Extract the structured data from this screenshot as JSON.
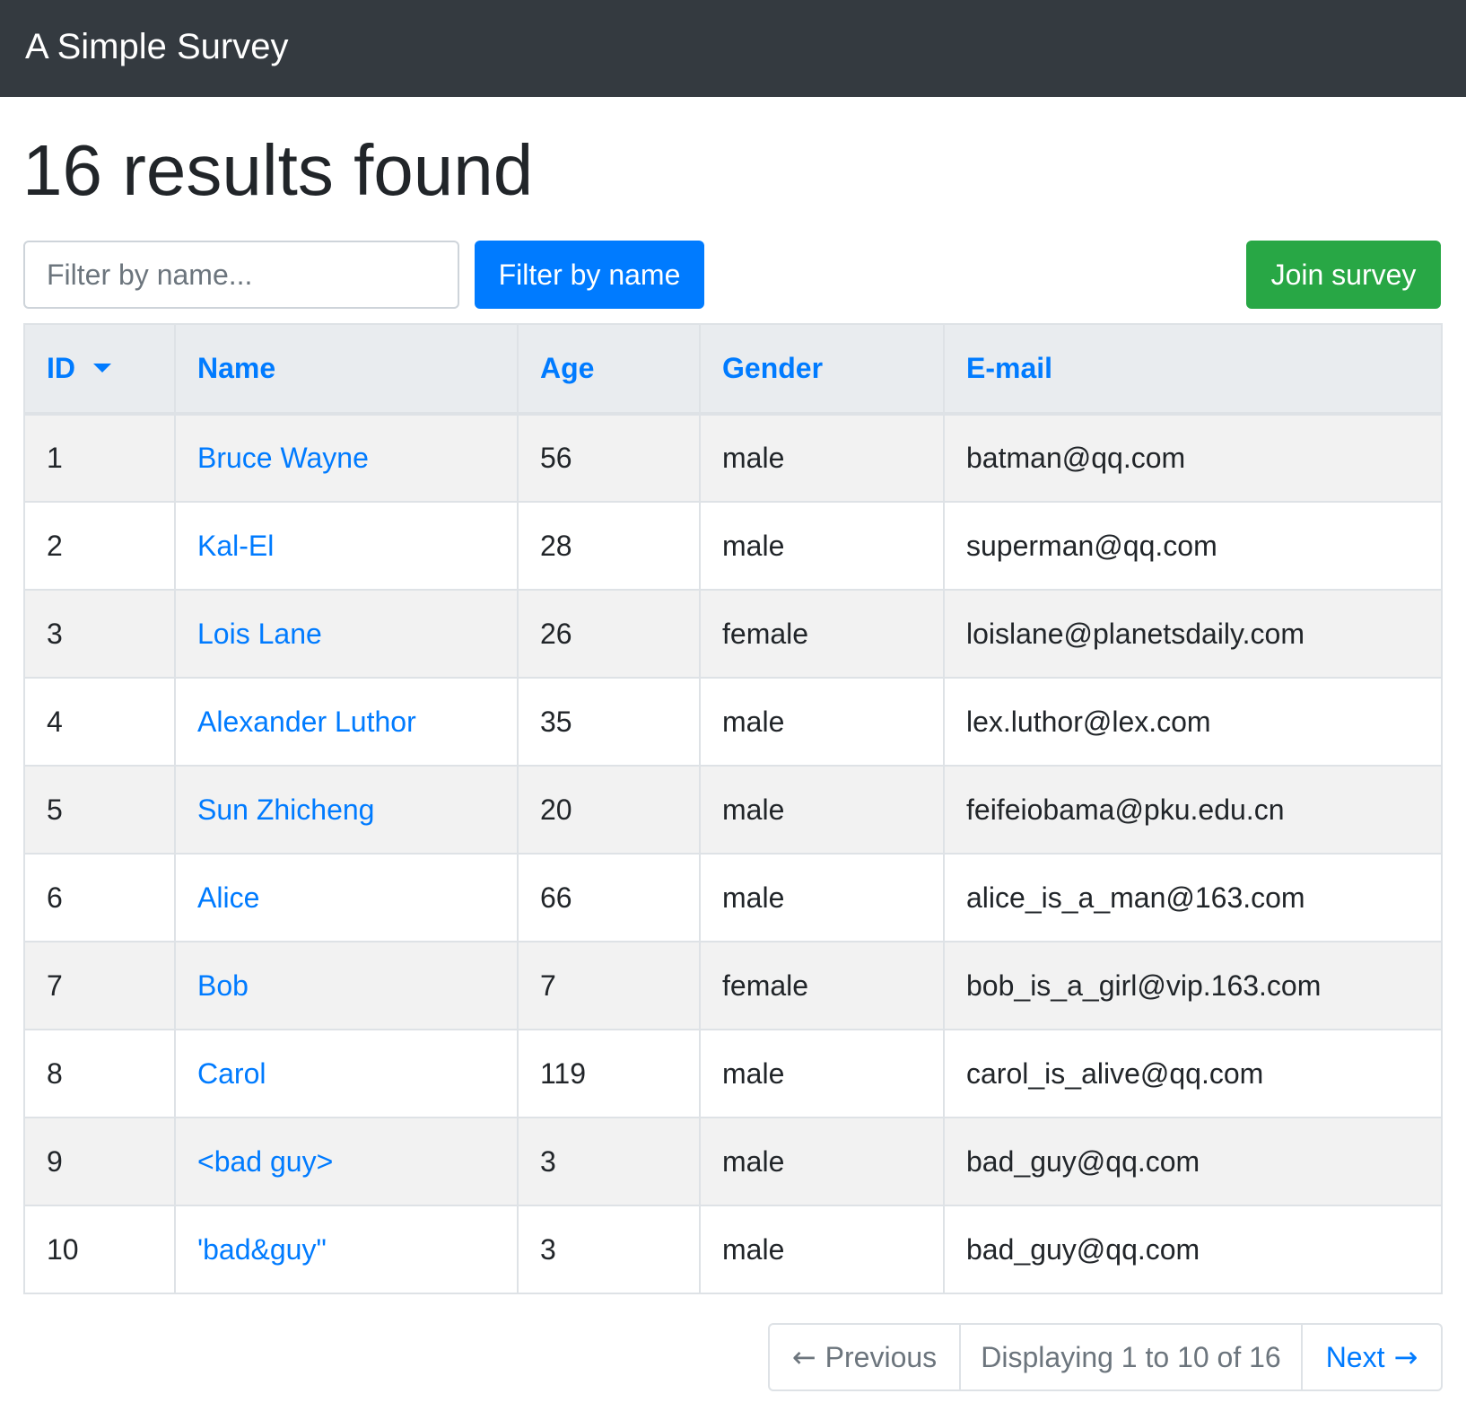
{
  "navbar": {
    "brand": "A Simple Survey"
  },
  "page": {
    "title": "16 results found"
  },
  "filter": {
    "placeholder": "Filter by name...",
    "value": "",
    "button_label": "Filter by name"
  },
  "join_button_label": "Join survey",
  "table": {
    "headers": [
      "ID",
      "Name",
      "Age",
      "Gender",
      "E-mail"
    ],
    "sort": {
      "column": "ID",
      "direction": "descending-caret"
    },
    "rows": [
      {
        "id": "1",
        "name": "Bruce Wayne",
        "age": "56",
        "gender": "male",
        "email": "batman@qq.com"
      },
      {
        "id": "2",
        "name": "Kal-El",
        "age": "28",
        "gender": "male",
        "email": "superman@qq.com"
      },
      {
        "id": "3",
        "name": "Lois Lane",
        "age": "26",
        "gender": "female",
        "email": "loislane@planetsdaily.com"
      },
      {
        "id": "4",
        "name": "Alexander Luthor",
        "age": "35",
        "gender": "male",
        "email": "lex.luthor@lex.com"
      },
      {
        "id": "5",
        "name": "Sun Zhicheng",
        "age": "20",
        "gender": "male",
        "email": "feifeiobama@pku.edu.cn"
      },
      {
        "id": "6",
        "name": "Alice",
        "age": "66",
        "gender": "male",
        "email": "alice_is_a_man@163.com"
      },
      {
        "id": "7",
        "name": "Bob",
        "age": "7",
        "gender": "female",
        "email": "bob_is_a_girl@vip.163.com"
      },
      {
        "id": "8",
        "name": "Carol",
        "age": "119",
        "gender": "male",
        "email": "carol_is_alive@qq.com"
      },
      {
        "id": "9",
        "name": "<bad guy>",
        "age": "3",
        "gender": "male",
        "email": "bad_guy@qq.com"
      },
      {
        "id": "10",
        "name": "'bad&guy\"",
        "age": "3",
        "gender": "male",
        "email": "bad_guy@qq.com"
      }
    ]
  },
  "pagination": {
    "previous_label": "Previous",
    "previous_arrow": "←",
    "info": "Displaying 1 to 10 of 16",
    "next_label": "Next",
    "next_arrow": "→"
  },
  "colors": {
    "navbar_bg": "#343a40",
    "primary": "#007bff",
    "success": "#28a745",
    "header_bg": "#e9ecef",
    "stripe_bg": "#f2f2f2",
    "muted": "#6c757d"
  },
  "icons": {
    "sort": "caret-down-icon",
    "previous": "arrow-left-icon",
    "next": "arrow-right-icon"
  }
}
